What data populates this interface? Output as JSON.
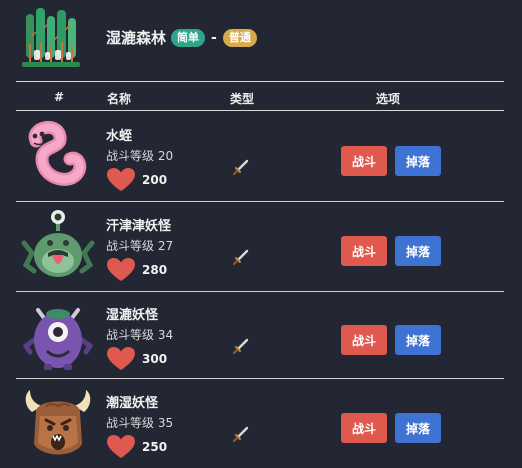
{
  "header": {
    "title": "湿漉森林",
    "difficulty": "简单",
    "separator": "-",
    "mode": "普通",
    "icon": "forest-icon"
  },
  "table": {
    "columns": [
      "#",
      "名称",
      "类型",
      "选项"
    ]
  },
  "monsters": [
    {
      "name": "水蛭",
      "level": "战斗等级 20",
      "hp": "200",
      "type_icon": "sword-icon",
      "fight_label": "战斗",
      "drop_label": "掉落",
      "avatar": "leech-avatar-icon"
    },
    {
      "name": "汗津津妖怪",
      "level": "战斗等级 27",
      "hp": "280",
      "type_icon": "sword-icon",
      "fight_label": "战斗",
      "drop_label": "掉落",
      "avatar": "frog-monster-avatar-icon"
    },
    {
      "name": "湿漉妖怪",
      "level": "战斗等级 34",
      "hp": "300",
      "type_icon": "sword-icon",
      "fight_label": "战斗",
      "drop_label": "掉落",
      "avatar": "one-eyed-monster-avatar-icon"
    },
    {
      "name": "潮湿妖怪",
      "level": "战斗等级 35",
      "hp": "250",
      "type_icon": "sword-icon",
      "fight_label": "战斗",
      "drop_label": "掉落",
      "avatar": "horned-beast-avatar-icon"
    }
  ],
  "colors": {
    "background": "#232733",
    "fight_button": "#e0594f",
    "drop_button": "#3e73d3",
    "badge_easy": "#2fa58a",
    "badge_normal": "#d9a94e",
    "heart": "#e0594f"
  }
}
